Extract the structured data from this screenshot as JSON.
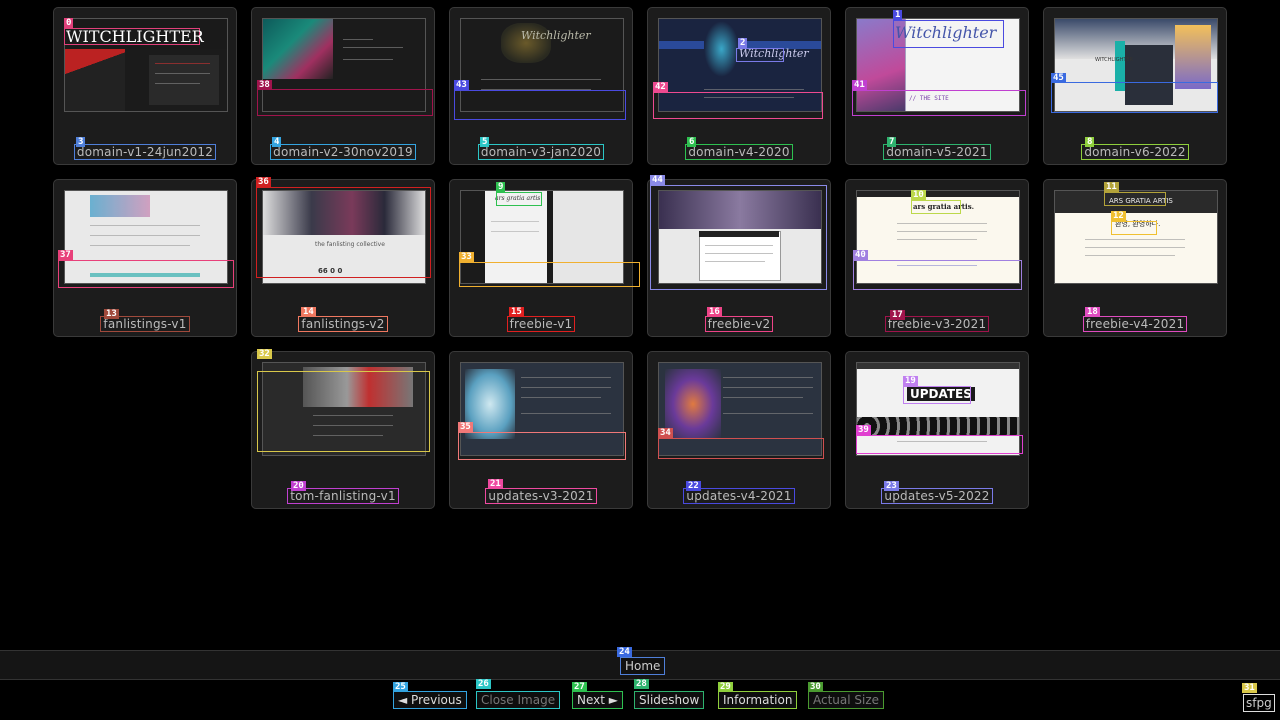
{
  "grid": {
    "items": [
      {
        "label": "domain-v1-24jun2012",
        "tag": "3",
        "tagColor": "#4f7fd9"
      },
      {
        "label": "domain-v2-30nov2019",
        "tag": "4",
        "tagColor": "#34a4e0"
      },
      {
        "label": "domain-v3-jan2020",
        "tag": "5",
        "tagColor": "#2cc6c6"
      },
      {
        "label": "domain-v4-2020",
        "tag": "6",
        "tagColor": "#2ec050"
      },
      {
        "label": "domain-v5-2021",
        "tag": "7",
        "tagColor": "#2eb36e"
      },
      {
        "label": "domain-v6-2022",
        "tag": "8",
        "tagColor": "#8fcf3c"
      },
      {
        "label": "fanlistings-v1",
        "tag": "13",
        "tagColor": "#a04a3c"
      },
      {
        "label": "fanlistings-v2",
        "tag": "14",
        "tagColor": "#f07860"
      },
      {
        "label": "freebie-v1",
        "tag": "15",
        "tagColor": "#e02020"
      },
      {
        "label": "freebie-v2",
        "tag": "16",
        "tagColor": "#ee4488"
      },
      {
        "label": "freebie-v3-2021",
        "tag": "17",
        "tagColor": "#a0144c"
      },
      {
        "label": "freebie-v4-2021",
        "tag": "18",
        "tagColor": "#e04cc0"
      },
      {
        "label": "tom-fanlisting-v1",
        "tag": "20",
        "tagColor": "#c040d0"
      },
      {
        "label": "updates-v3-2021",
        "tag": "21",
        "tagColor": "#ee4aa0"
      },
      {
        "label": "updates-v4-2021",
        "tag": "22",
        "tagColor": "#4a4ae0"
      },
      {
        "label": "updates-v5-2022",
        "tag": "23",
        "tagColor": "#7a7ae8"
      }
    ]
  },
  "thumb_text": {
    "witchlighter_caps": "WITCHLIGHTER",
    "witchlighter_script": "Witchlighter",
    "ars_gratia": "ars gratia artis",
    "ars_gratia_dot": "ars gratia artis.",
    "ars_gratia_caps": "ARS GRATIA ARTIS",
    "korean": "환영, 환영하다.",
    "updates": "UPDATES",
    "the_site": "// THE SITE",
    "fanlisting": "the fanlisting collective",
    "counts": "66   0   0",
    "witchlighter_v6": "WITCHLIGHTER"
  },
  "overlay_tags": {
    "t0": "0",
    "t1": "1",
    "t2": "2",
    "t9": "9",
    "t10": "10",
    "t11": "11",
    "t12": "12",
    "t19": "19",
    "t24": "24",
    "t25": "25",
    "t26": "26",
    "t27": "27",
    "t28": "28",
    "t29": "29",
    "t30": "30",
    "t31": "31",
    "t32": "32",
    "t33": "33",
    "t34": "34",
    "t35": "35",
    "t36": "36",
    "t37": "37",
    "t38": "38",
    "t39": "39",
    "t40": "40",
    "t41": "41",
    "t42": "42",
    "t43": "43",
    "t44": "44",
    "t45": "45"
  },
  "nav": {
    "home": "Home",
    "previous": "◄ Previous",
    "close": "Close Image",
    "next": "Next ►",
    "slideshow": "Slideshow",
    "information": "Information",
    "actual_size": "Actual Size"
  },
  "brand": "sfpg"
}
